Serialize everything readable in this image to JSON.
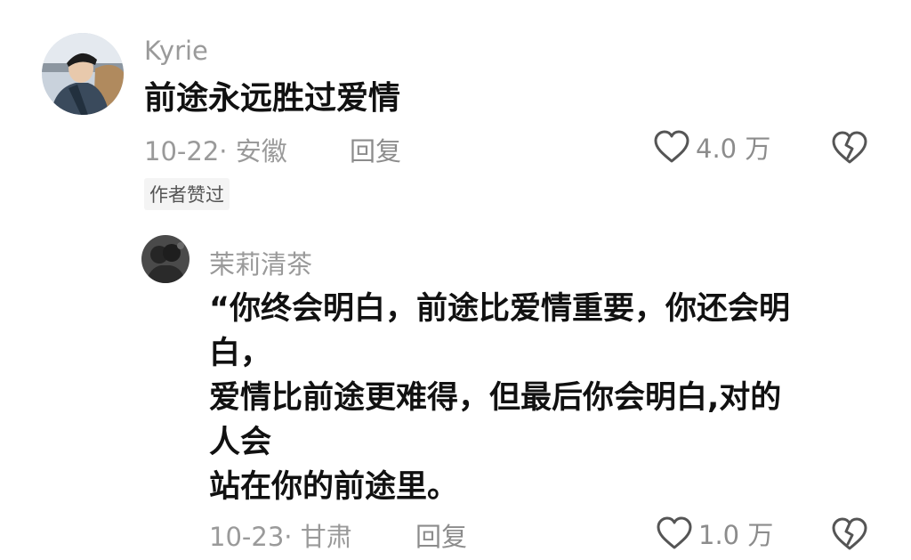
{
  "comments": [
    {
      "author": "Kyrie",
      "text": "前途永远胜过爱情",
      "date_location": "10-22· 安徽",
      "reply_label": "回复",
      "likes": "4.0 万",
      "badge": "作者赞过"
    },
    {
      "author": "茉莉清茶",
      "text_lines": [
        "“你终会明白，前途比爱情重要，你还会明",
        "白，",
        "爱情比前途更难得，但最后你会明白,对的",
        "人会",
        "站在你的前途里。"
      ],
      "date_location": "10-23· 甘肃",
      "reply_label": "回复",
      "likes": "1.0 万"
    }
  ]
}
